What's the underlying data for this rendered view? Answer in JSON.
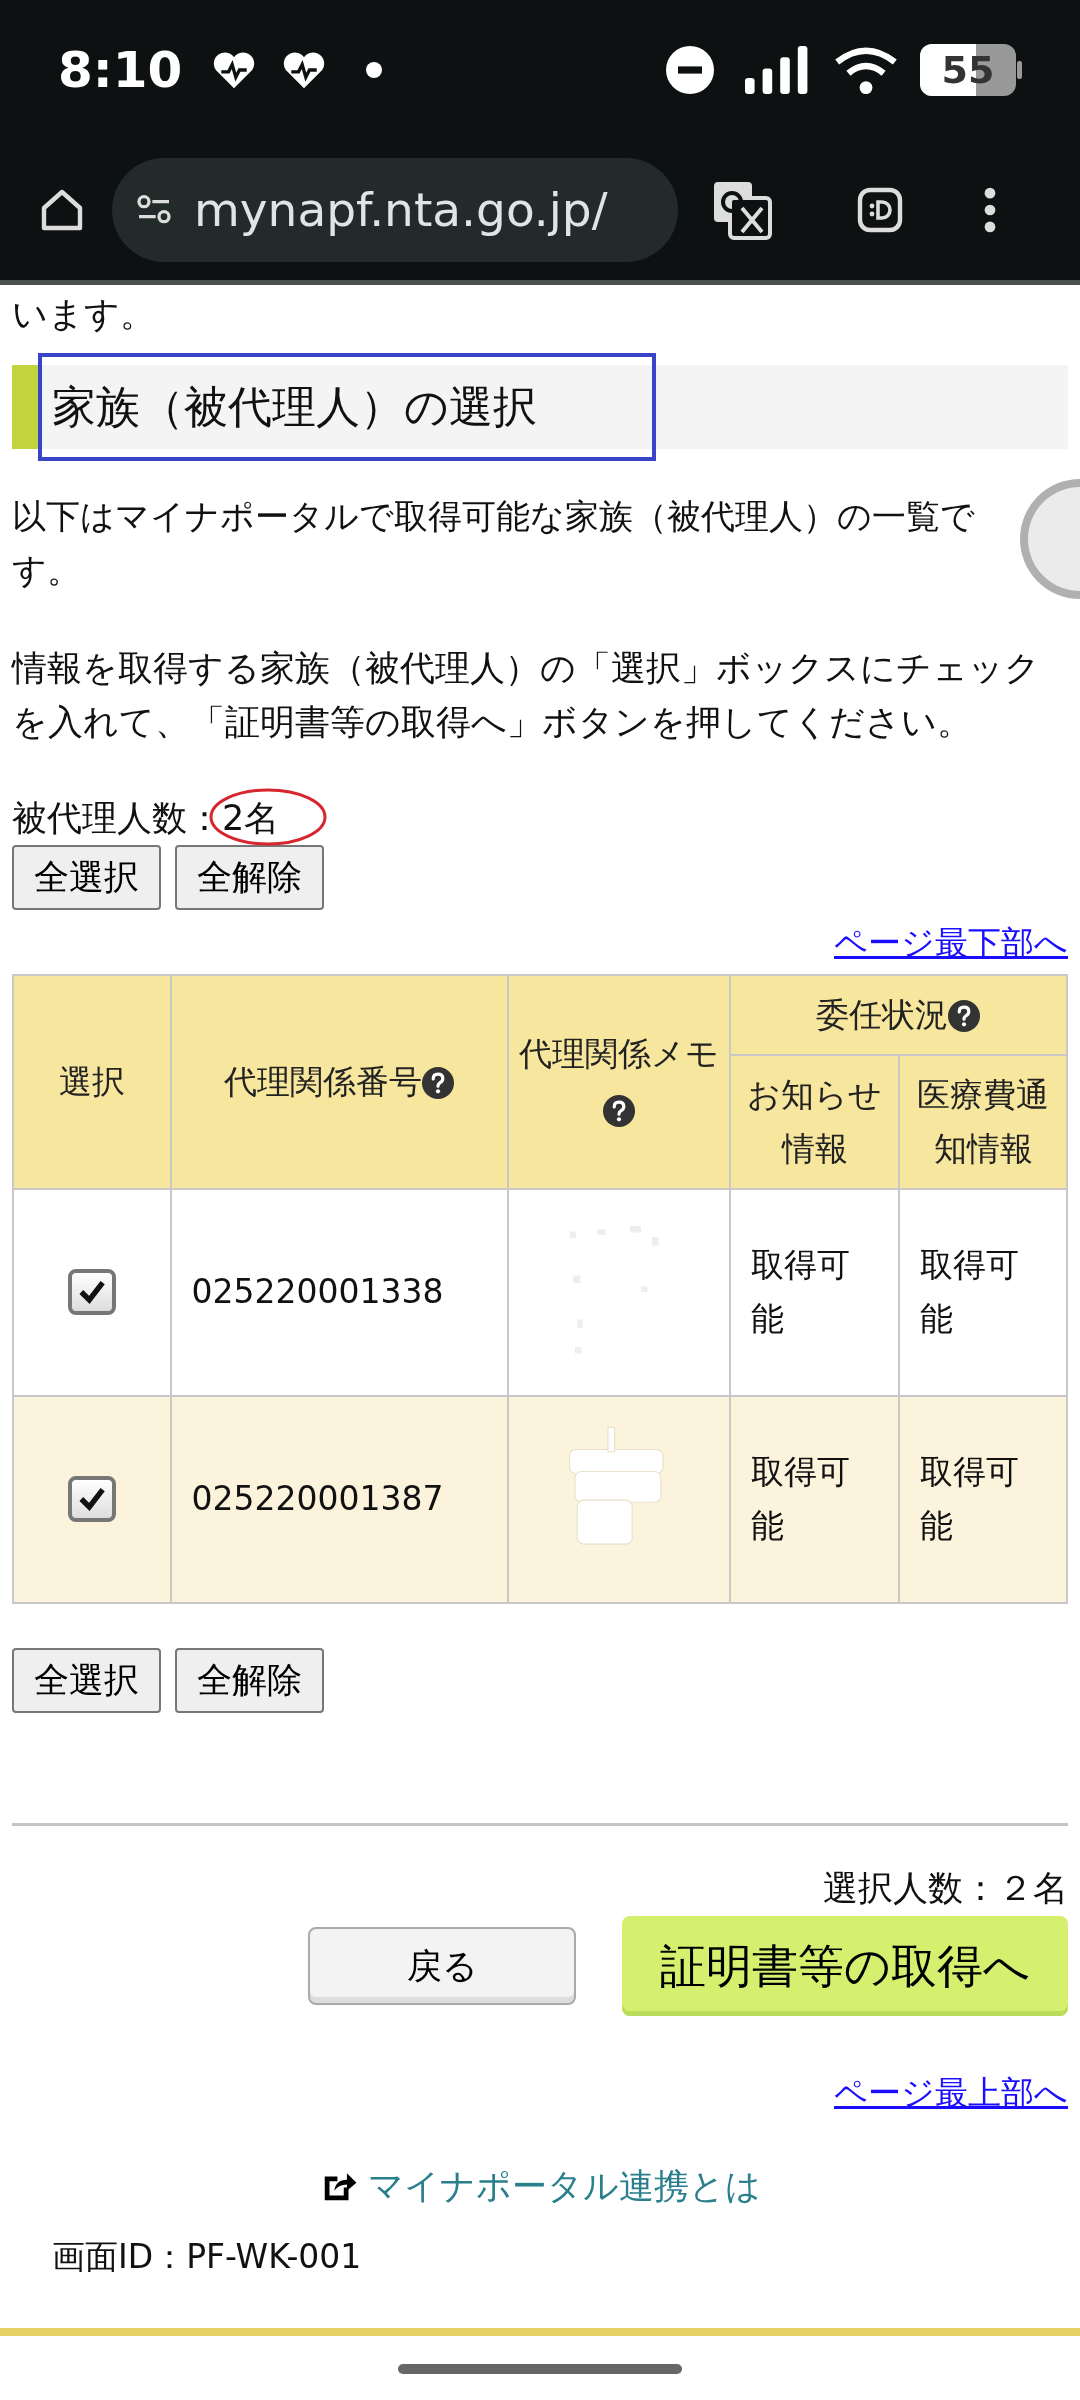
{
  "status_bar": {
    "time": "8:10",
    "battery": "55"
  },
  "browser": {
    "url": "mynapf.nta.go.jp/"
  },
  "page": {
    "intro_tail": "います。",
    "heading": "家族（被代理人）の選択",
    "paragraphs": [
      "以下はマイナポータルで取得可能な家族（被代理人）の一覧です。",
      "情報を取得する家族（被代理人）の「選択」ボックスにチェックを入れて、「証明書等の取得へ」ボタンを押してください。"
    ],
    "count_label": "被代理人数：2名",
    "top_buttons": [
      "全選択",
      "全解除"
    ],
    "to_bottom_link": "ページ最下部へ",
    "table": {
      "columns": [
        {
          "label": "選択",
          "help": false
        },
        {
          "label": "代理関係番号",
          "help": true
        },
        {
          "label": "代理関係メモ",
          "help": true
        }
      ],
      "group": {
        "label": "委任状況",
        "help": true,
        "columns": [
          "お知らせ情報",
          "医療費通知情報"
        ]
      },
      "rows": [
        {
          "checked": true,
          "number": "025220001338",
          "notice": "取得可能",
          "medical": "取得可能"
        },
        {
          "checked": true,
          "number": "025220001387",
          "notice": "取得可能",
          "medical": "取得可能"
        }
      ]
    },
    "bottom_buttons": [
      "全選択",
      "全解除"
    ],
    "selected_count": "選択人数：２名",
    "back_button": "戻る",
    "primary_button": "証明書等の取得へ",
    "to_top_link": "ページ最上部へ",
    "external_link": "マイナポータル連携とは",
    "screen_id": "画面ID：PF-WK-001"
  }
}
